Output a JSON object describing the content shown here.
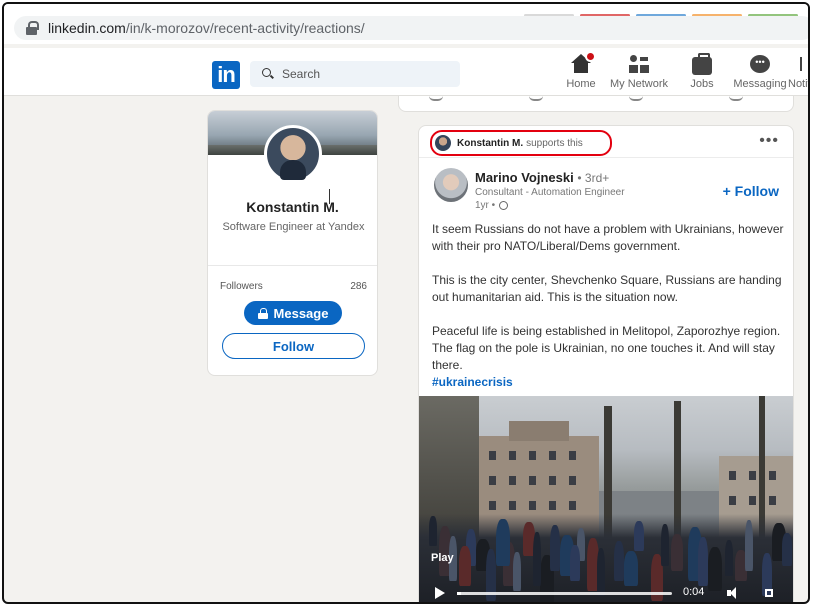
{
  "browser": {
    "url_host": "linkedin.com",
    "url_path": "/in/k-morozov/recent-activity/reactions/",
    "tab_colors": [
      "#d9d9d9",
      "#e06666",
      "#6fa8dc",
      "#f6b26b",
      "#93c47d"
    ]
  },
  "nav": {
    "logo": "in",
    "search_placeholder": "Search",
    "items": [
      {
        "label": "Home",
        "icon": "home-icon"
      },
      {
        "label": "My Network",
        "icon": "network-icon"
      },
      {
        "label": "Jobs",
        "icon": "jobs-icon"
      },
      {
        "label": "Messaging",
        "icon": "messaging-icon"
      },
      {
        "label": "Notif",
        "icon": "notifications-icon"
      }
    ]
  },
  "profile": {
    "name": "Konstantin M.",
    "headline": "Software Engineer at Yandex",
    "followers_label": "Followers",
    "followers_count": "286",
    "message_label": "Message",
    "follow_label": "Follow"
  },
  "post": {
    "supporter_name": "Konstantin M.",
    "supporter_action": "supports this",
    "more_label": "•••",
    "author_name": "Marino Vojneski",
    "author_degree": "• 3rd+",
    "author_title": "Consultant - Automation Engineer",
    "author_time": "1yr •",
    "follow_label": "+ Follow",
    "paragraphs": [
      "It seem Russians do not have a problem with Ukrainians, however with their pro NATO/Liberal/Dems government.",
      "This is the city center, Shevchenko Square, Russians are handing out humanitarian aid. This is the situation now.",
      "Peaceful life is being established in Melitopol, Zaporozhye region. The flag on the pole is Ukrainian, no one touches it. And will stay there."
    ],
    "hashtag": "#ukrainecrisis",
    "video": {
      "play_label": "Play",
      "time": "0:04",
      "progress": 0.02
    }
  },
  "colors": {
    "accent": "#0a66c2",
    "highlight": "#e3000f",
    "page_bg": "#f3f2ef"
  }
}
